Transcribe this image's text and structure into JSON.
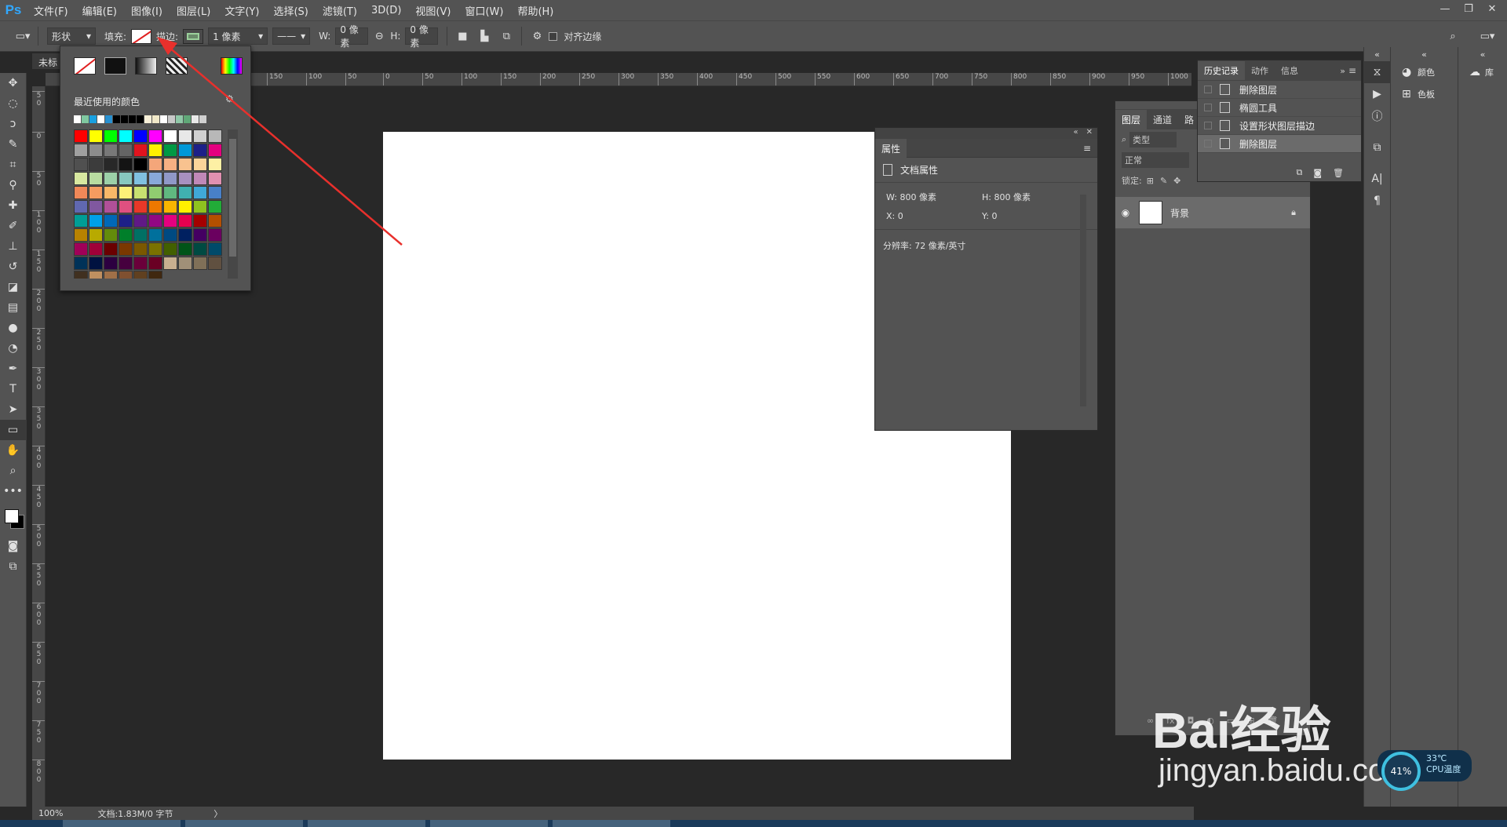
{
  "app": {
    "logo": "Ps"
  },
  "menu": [
    "文件(F)",
    "编辑(E)",
    "图像(I)",
    "图层(L)",
    "文字(Y)",
    "选择(S)",
    "滤镜(T)",
    "3D(D)",
    "视图(V)",
    "窗口(W)",
    "帮助(H)"
  ],
  "window_controls": [
    "—",
    "❐",
    "✕"
  ],
  "options": {
    "mode": "形状",
    "fill_label": "填充:",
    "stroke_label": "描边:",
    "stroke_width": "1 像素",
    "w_label": "W:",
    "w_value": "0 像素",
    "h_label": "H:",
    "h_value": "0 像素",
    "align_edges": "对齐边缘"
  },
  "document": {
    "tab_title": "未标"
  },
  "ruler": {
    "h_ticks": [
      "150",
      "100",
      "50",
      "0",
      "50",
      "100",
      "150",
      "200",
      "250",
      "300",
      "350",
      "400",
      "450",
      "500",
      "550",
      "600",
      "650",
      "700",
      "750",
      "800",
      "850",
      "900",
      "950",
      "1000"
    ],
    "v_ticks": [
      "5\n0",
      "0",
      "5\n0",
      "1\n0\n0",
      "1\n5\n0",
      "2\n0\n0",
      "2\n5\n0",
      "3\n0\n0",
      "3\n5\n0",
      "4\n0\n0",
      "4\n5\n0",
      "5\n0\n0",
      "5\n5\n0",
      "6\n0\n0",
      "6\n5\n0",
      "7\n0\n0",
      "7\n5\n0",
      "8\n0\n0"
    ]
  },
  "status": {
    "zoom": "100%",
    "doc_info": "文档:1.83M/0 字节",
    "arrow": "〉"
  },
  "color_picker": {
    "recent_title": "最近使用的颜色",
    "recent_colors": [
      "#ffffff",
      "#7fc8a0",
      "#19a0e0",
      "#ffffff",
      "#2890d0",
      "#000000",
      "#000000",
      "#000000",
      "#000000",
      "#f8f0d8",
      "#f0e8c8",
      "#ffffff",
      "#c8c8c8",
      "#90c8a8",
      "#60a878",
      "#e8e8e8",
      "#d0d0d0"
    ],
    "swatches": [
      "#ff0000",
      "#ffff00",
      "#00ff00",
      "#00ffff",
      "#0000ff",
      "#ff00ff",
      "#ffffff",
      "#e8e8e8",
      "#d0d0d0",
      "#b8b8b8",
      "#a0a0a0",
      "#8c8c8c",
      "#787878",
      "#646464",
      "#e0141e",
      "#fff000",
      "#009944",
      "#0098d8",
      "#1d2088",
      "#e4007f",
      "#505050",
      "#3c3c3c",
      "#282828",
      "#141414",
      "#000000",
      "#f4a67a",
      "#f6b083",
      "#f8c28f",
      "#fbd49a",
      "#fdf0a4",
      "#d8e8a0",
      "#b8dca0",
      "#9cd0a8",
      "#88c8c0",
      "#80c0e0",
      "#88a8d8",
      "#9098c8",
      "#a890c0",
      "#c088b8",
      "#e090b0",
      "#f08858",
      "#f49c60",
      "#f8b868",
      "#fcf078",
      "#c8e070",
      "#90cc70",
      "#60b880",
      "#40b0b0",
      "#40a8d8",
      "#4880c8",
      "#6068b0",
      "#8058a0",
      "#b05098",
      "#e05080",
      "#e83828",
      "#ee7800",
      "#f8b500",
      "#fff100",
      "#8fc31f",
      "#22ac38",
      "#009e96",
      "#00a0e9",
      "#0068b7",
      "#1d2088",
      "#601986",
      "#920783",
      "#e4007f",
      "#e5004f",
      "#a40000",
      "#b45000",
      "#b88200",
      "#b8aa00",
      "#638c0b",
      "#007f2a",
      "#007064",
      "#00709c",
      "#004a82",
      "#002060",
      "#440062",
      "#6a005f",
      "#a00058",
      "#a00038",
      "#6a0000",
      "#7a3800",
      "#7a5800",
      "#7a7200",
      "#426000",
      "#005418",
      "#004a42",
      "#004a6a",
      "#003258",
      "#001240",
      "#2c0040",
      "#46003e",
      "#6a003a",
      "#6a0024",
      "#c8b090",
      "#a09078",
      "#807058",
      "#605040",
      "#403020",
      "#c09060",
      "#a07048",
      "#805030",
      "#604020",
      "#402810"
    ]
  },
  "properties": {
    "tab": "属性",
    "header": "文档属性",
    "w_label": "W:",
    "w_value": "800 像素",
    "h_label": "H:",
    "h_value": "800 像素",
    "x_label": "X:",
    "x_value": "0",
    "y_label": "Y:",
    "y_value": "0",
    "resolution": "分辨率: 72 像素/英寸"
  },
  "layers": {
    "tabs": [
      "图层",
      "通道",
      "路"
    ],
    "search_placeholder": "类型",
    "blend_mode": "正常",
    "lock_label": "锁定:",
    "layer_name": "背景"
  },
  "history": {
    "tabs": [
      "历史记录",
      "动作",
      "信息"
    ],
    "items": [
      "删除图层",
      "椭圆工具",
      "设置形状图层描边",
      "删除图层"
    ]
  },
  "right_panels": {
    "color": "颜色",
    "swatches": "色板",
    "library": "库"
  },
  "watermark": {
    "logo": "Bai经验",
    "url": "jingyan.baidu.com"
  },
  "cpu": {
    "temp": "33℃",
    "label": "CPU温度",
    "pct": "41%"
  }
}
